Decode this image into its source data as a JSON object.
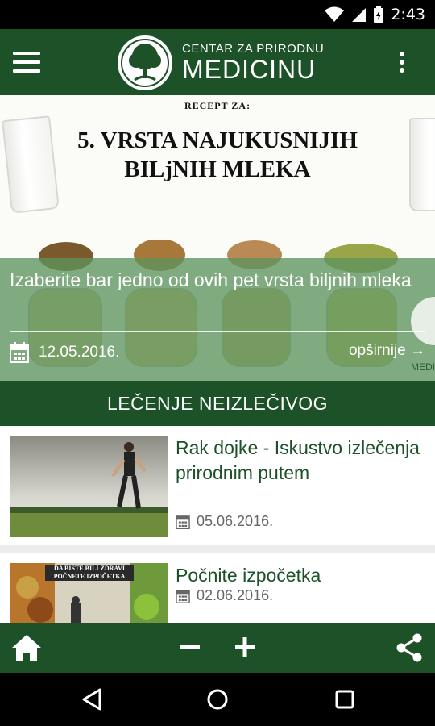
{
  "status_bar": {
    "time": "2:43"
  },
  "app_bar": {
    "logo_top": "CENTAR ZA PRIRODNU",
    "logo_main": "MEDICINU",
    "menu_icon": "hamburger-menu-icon",
    "overflow_icon": "more-vert-icon"
  },
  "hero": {
    "recept_label": "RECEPT ZA:",
    "title": "5. VRSTA NAJUKUSNIJIH BILjNIH MLEKA",
    "headline": "Izaberite bar jedno od ovih pet vrsta biljnih mleka",
    "date": "12.05.2016.",
    "more": "opširnije →",
    "badge_text": "MEDI"
  },
  "section": {
    "title": "LEČENJE NEIZLEČIVOG"
  },
  "articles": [
    {
      "title": "Rak dojke - Iskustvo izlečenja prirodnim putem",
      "date": "05.06.2016."
    },
    {
      "title": "Počnite izpočetka",
      "date": "02.06.2016.",
      "thumb_banner": "DA BISTE BILI ZDRAVI POČNETE IZPOČETKA"
    }
  ],
  "toolbar": {
    "home_icon": "home-icon",
    "zoom_out_icon": "minus-icon",
    "zoom_in_icon": "plus-icon",
    "share_icon": "share-icon"
  },
  "colors": {
    "primary": "#1d5128",
    "overlay": "#5d945c",
    "article_title": "#1d5128"
  }
}
